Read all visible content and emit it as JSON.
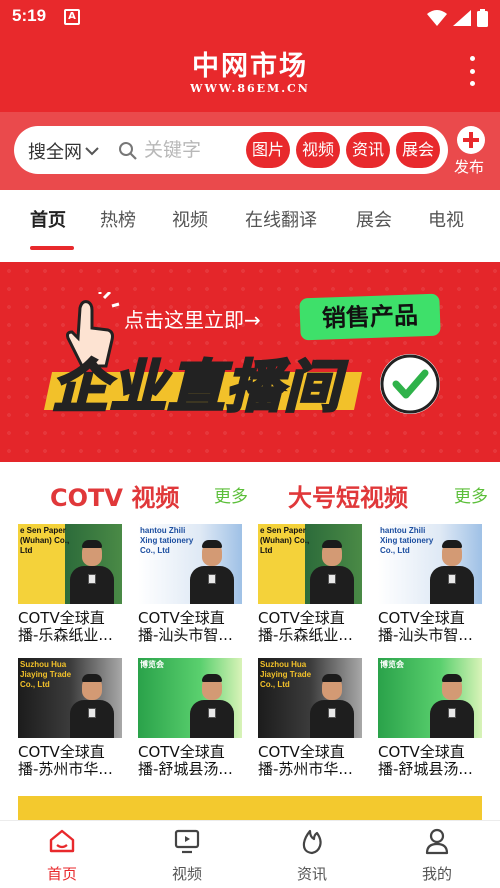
{
  "status_bar": {
    "time": "5:19",
    "notification_glyph": "A"
  },
  "header": {
    "title": "中网市场",
    "subtitle": "WWW.86EM.CN"
  },
  "search": {
    "scope": "搜全网",
    "placeholder": "关键字",
    "chips": [
      "图片",
      "视频",
      "资讯",
      "展会"
    ],
    "publish_label": "发布"
  },
  "tabs": [
    "首页",
    "热榜",
    "视频",
    "在线翻译",
    "展会",
    "电视"
  ],
  "active_tab": 0,
  "banner": {
    "cta": "点击这里立即→",
    "badge": "销售产品",
    "headline": "企业直播间"
  },
  "sections": {
    "left": {
      "title": "COTV 视频",
      "more": "更多"
    },
    "right": {
      "title": "大号短视频",
      "more": "更多"
    }
  },
  "videos": [
    {
      "title": "COTV全球直播-乐森纸业...",
      "thumb_text": "e Sen Paper (Wuhan) Co., Ltd"
    },
    {
      "title": "COTV全球直播-汕头市智...",
      "thumb_text": "hantou Zhili Xing tationery Co., Ltd"
    },
    {
      "title": "COTV全球直播-乐森纸业...",
      "thumb_text": "e Sen Paper (Wuhan) Co., Ltd"
    },
    {
      "title": "COTV全球直播-汕头市智...",
      "thumb_text": "hantou Zhili Xing tationery Co., Ltd"
    },
    {
      "title": "COTV全球直播-苏州市华...",
      "thumb_text": "Suzhou Hua Jiaying Trade Co., Ltd"
    },
    {
      "title": "COTV全球直播-舒城县汤...",
      "thumb_text": "博览会"
    },
    {
      "title": "COTV全球直播-苏州市华...",
      "thumb_text": "Suzhou Hua Jiaying Trade Co., Ltd"
    },
    {
      "title": "COTV全球直播-舒城县汤...",
      "thumb_text": "博览会"
    }
  ],
  "bottom_nav": [
    {
      "label": "首页",
      "icon": "home-icon"
    },
    {
      "label": "视频",
      "icon": "video-icon"
    },
    {
      "label": "资讯",
      "icon": "news-fire-icon"
    },
    {
      "label": "我的",
      "icon": "profile-icon"
    }
  ],
  "colors": {
    "brand_red": "#e8292c",
    "more_green": "#5cbf3a",
    "banner_green": "#3ee06a",
    "banner_yellow": "#f2c12a"
  }
}
